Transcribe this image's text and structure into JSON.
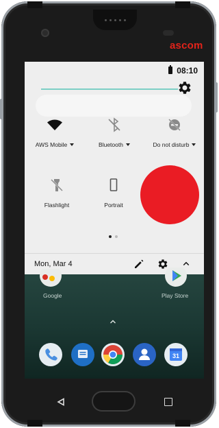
{
  "device": {
    "brand": "ascom"
  },
  "status_bar": {
    "time": "08:10"
  },
  "quick_settings": {
    "tiles": [
      {
        "label": "AWS Mobile",
        "icon": "wifi-icon",
        "has_dropdown": true
      },
      {
        "label": "Bluetooth",
        "icon": "bluetooth-off-icon",
        "has_dropdown": true
      },
      {
        "label": "Do not disturb",
        "icon": "do-not-disturb-icon",
        "has_dropdown": true
      },
      {
        "label": "Flashlight",
        "icon": "flashlight-off-icon",
        "has_dropdown": false
      },
      {
        "label": "Portrait",
        "icon": "portrait-icon",
        "has_dropdown": false
      }
    ],
    "page_count": 2,
    "current_page": 1
  },
  "footer": {
    "date": "Mon, Mar 4"
  },
  "home": {
    "apps": [
      {
        "label": "Google"
      },
      {
        "label": "Play Store"
      }
    ],
    "dock": [
      "phone-icon",
      "messages-icon",
      "chrome-icon",
      "contacts-icon",
      "calendar-icon"
    ],
    "calendar_day": "31"
  },
  "colors": {
    "accent": "#7ccfc5",
    "brand": "#e2231a",
    "red_dot": "#ea1c24",
    "panel": "#eeeeee"
  }
}
